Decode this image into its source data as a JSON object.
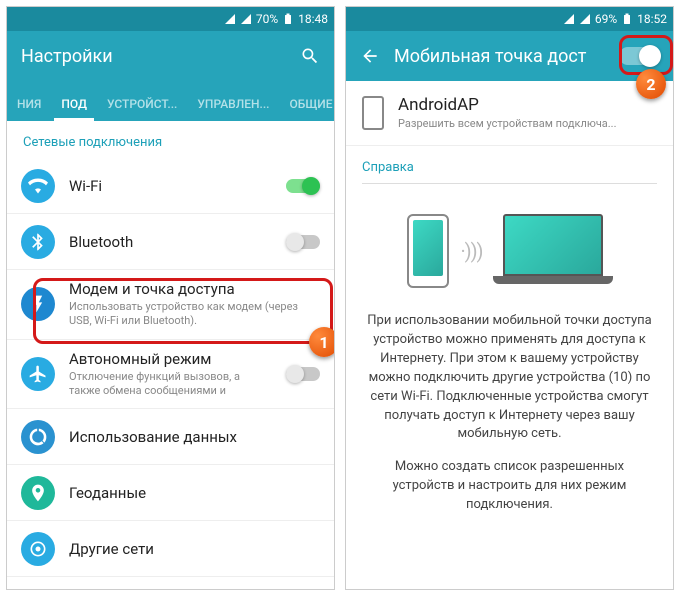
{
  "left": {
    "status": {
      "battery": "70%",
      "time": "18:48"
    },
    "header": {
      "title": "Настройки"
    },
    "tabs": [
      "НИЯ",
      "ПОД",
      "УСТРОЙСТ...",
      "УПРАВЛЕН...",
      "ОБЩИЕ"
    ],
    "section": "Сетевые подключения",
    "items": [
      {
        "title": "Wi-Fi",
        "color": "#29abe2"
      },
      {
        "title": "Bluetooth",
        "color": "#29abe2"
      },
      {
        "title": "Модем и точка доступа",
        "sub": "Использовать устройство как модем (через USB, Wi-Fi или Bluetooth).",
        "color": "#1e88d0"
      },
      {
        "title": "Автономный режим",
        "sub": "Отключение функций вызовов, а также обмена сообщениями и",
        "color": "#29abe2"
      },
      {
        "title": "Использование данных",
        "color": "#2a92d0"
      },
      {
        "title": "Геоданные",
        "color": "#1fb89a"
      },
      {
        "title": "Другие сети",
        "color": "#29abe2"
      }
    ]
  },
  "right": {
    "status": {
      "battery": "69%",
      "time": "18:52"
    },
    "header": {
      "title": "Мобильная точка дост"
    },
    "ap": {
      "name": "AndroidAP",
      "sub": "Разрешить всем устройствам подключа..."
    },
    "help_label": "Справка",
    "info1": "При использовании мобильной точки доступа устройство можно применять для доступа к Интернету. При этом к вашему устройству можно подключить другие устройства (10) по сети Wi-Fi. Подключенные устройства смогут получать доступ к Интернету через вашу мобильную сеть.",
    "info2": "Можно создать список разрешенных устройств и настроить для них режим подключения."
  },
  "badges": {
    "b1": "1",
    "b2": "2"
  }
}
